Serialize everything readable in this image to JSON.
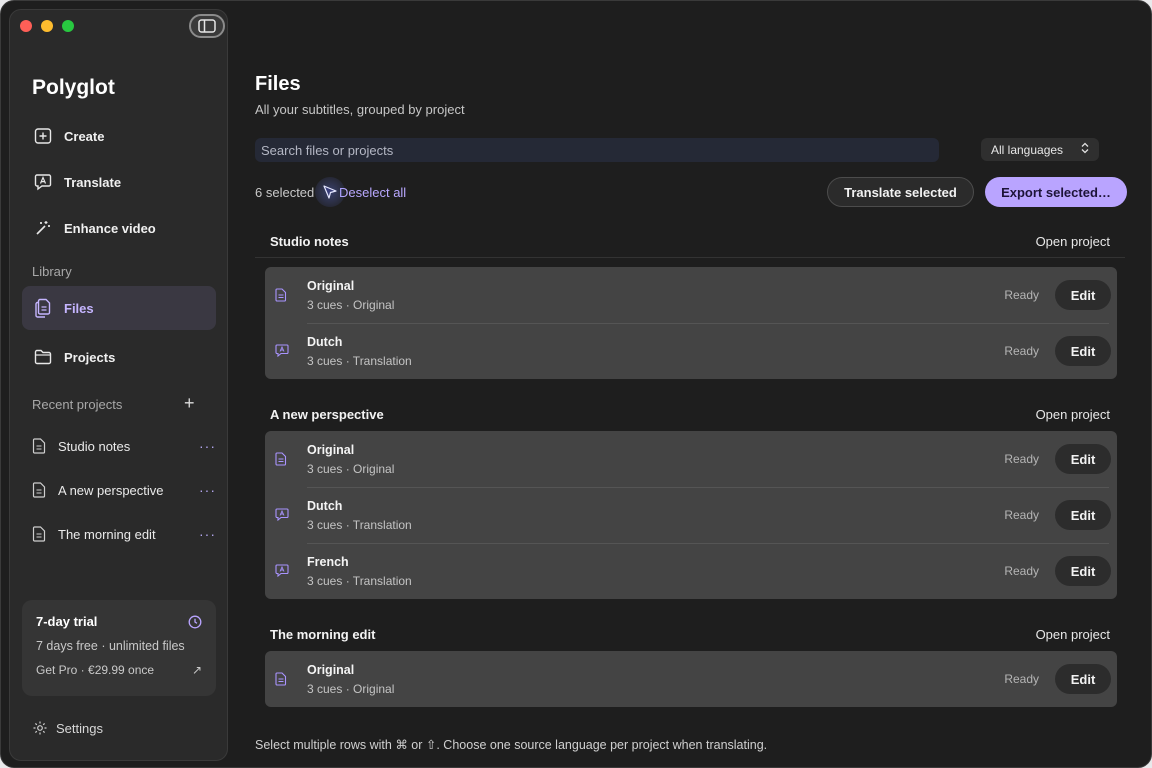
{
  "sidebar": {
    "app_title": "Polyglot",
    "nav": [
      {
        "label": "Create",
        "icon": "plus-square-icon"
      },
      {
        "label": "Translate",
        "icon": "translate-bubble-icon"
      },
      {
        "label": "Enhance video",
        "icon": "magic-wand-icon"
      }
    ],
    "library_label": "Library",
    "library": [
      {
        "label": "Files",
        "icon": "files-icon",
        "active": true
      },
      {
        "label": "Projects",
        "icon": "folder-icon"
      }
    ],
    "recent_label": "Recent projects",
    "recent_add": "+",
    "recent": [
      {
        "label": "Studio notes",
        "more": "···"
      },
      {
        "label": "A new perspective",
        "more": "···"
      },
      {
        "label": "The morning edit",
        "more": "···"
      }
    ],
    "trial": {
      "title": "7-day trial",
      "subtitle": "7 days free · unlimited files",
      "cta": "Get Pro · €29.99 once",
      "cta_arrow": "↗"
    },
    "settings_label": "Settings"
  },
  "main": {
    "title": "Files",
    "subtitle": "All your subtitles, grouped by project",
    "search_placeholder": "Search files or projects",
    "language_filter": "All languages",
    "language_chevron": "⌃⌄",
    "selected_count": "6 selected",
    "deselect_label": "Deselect all",
    "translate_selected": "Translate selected",
    "export_selected": "Export selected…",
    "groups": [
      {
        "name": "Studio notes",
        "open_label": "Open project",
        "rows": [
          {
            "name": "Original",
            "sub": "3 cues · Original",
            "status": "Ready",
            "action": "Edit",
            "type": "original"
          },
          {
            "name": "Dutch",
            "sub": "3 cues · Translation",
            "status": "Ready",
            "action": "Edit",
            "type": "translation"
          }
        ]
      },
      {
        "name": "A new perspective",
        "open_label": "Open project",
        "rows": [
          {
            "name": "Original",
            "sub": "3 cues · Original",
            "status": "Ready",
            "action": "Edit",
            "type": "original"
          },
          {
            "name": "Dutch",
            "sub": "3 cues · Translation",
            "status": "Ready",
            "action": "Edit",
            "type": "translation"
          },
          {
            "name": "French",
            "sub": "3 cues · Translation",
            "status": "Ready",
            "action": "Edit",
            "type": "translation"
          }
        ]
      },
      {
        "name": "The morning edit",
        "open_label": "Open project",
        "rows": [
          {
            "name": "Original",
            "sub": "3 cues · Original",
            "status": "Ready",
            "action": "Edit",
            "type": "original"
          }
        ]
      }
    ],
    "footer_hint": "Select multiple rows with ⌘ or ⇧. Choose one source language per project when translating."
  },
  "colors": {
    "accent": "#b9a4ff",
    "accent_text": "#c5b5ff",
    "background": "#1e1e1e",
    "sidebar": "#2a2a2a",
    "card": "#444444"
  }
}
